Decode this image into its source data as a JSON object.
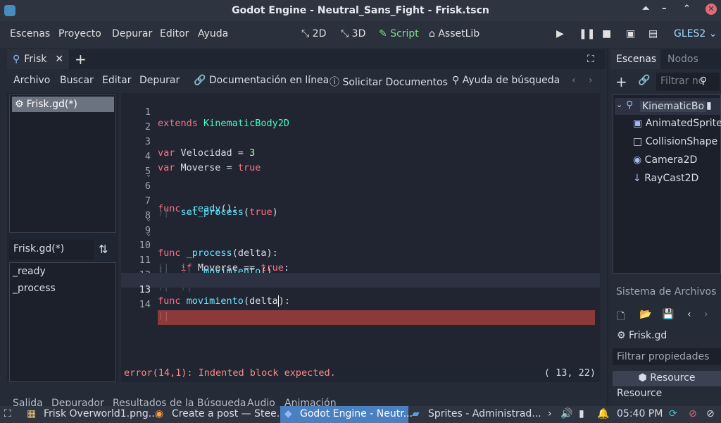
{
  "window": {
    "title": "Godot Engine - Neutral_Sans_Fight - Frisk.tscn"
  },
  "menu": {
    "items": [
      "Escenas",
      "Proyecto",
      "Depurar",
      "Editor",
      "Ayuda"
    ]
  },
  "modes": {
    "m2d": "2D",
    "m3d": "3D",
    "script": "Script",
    "assetlib": "AssetLib"
  },
  "renderer": "GLES2",
  "scene_tab": {
    "label": "Frisk"
  },
  "script_toolbar": {
    "archivo": "Archivo",
    "buscar": "Buscar",
    "editar": "Editar",
    "depurar": "Depurar",
    "docs_online": "Documentación en línea",
    "request_docs": "Solicitar Documentos",
    "search_help": "Ayuda de búsqueda"
  },
  "script_list": {
    "items": [
      "Frisk.gd(*)"
    ]
  },
  "filter": {
    "value": "Frisk.gd(*)"
  },
  "methods": [
    "_ready",
    "_process"
  ],
  "editor": {
    "lines": [
      {
        "n": "1"
      },
      {
        "n": "2"
      },
      {
        "n": "3"
      },
      {
        "n": "4"
      },
      {
        "n": "5"
      },
      {
        "n": "6"
      },
      {
        "n": "7"
      },
      {
        "n": "8"
      },
      {
        "n": "9"
      },
      {
        "n": "10"
      },
      {
        "n": "11"
      },
      {
        "n": "12"
      },
      {
        "n": "13"
      },
      {
        "n": "14"
      }
    ],
    "code": {
      "l1_kw": "extends",
      "l1_ty": "KinematicBody2D",
      "l3_kw": "var",
      "l3_rest": "Velocidad = ",
      "l3_num": "3",
      "l4_kw": "var",
      "l4_rest": "Moverse = ",
      "l4_val": "true",
      "l6_kw": "func",
      "l6_fn": "_ready",
      "l6_rest": "():",
      "l7_fn": "set_process",
      "l7_rest": "(",
      "l7_val": "true",
      "l7_end": ")",
      "l9_kw": "func",
      "l9_fn": "_process",
      "l9_rest": "(delta):",
      "l10_kw": "if",
      "l10_rest": "Moverse == ",
      "l10_val": "true",
      "l10_end": ":",
      "l11_fn": "movimiento",
      "l11_rest": "()",
      "l13_kw": "func",
      "l13_fn": "movimiento",
      "l13_rest": "(delta",
      "l13_end": "):"
    }
  },
  "status": {
    "error": "error(14,1): Indented block expected.",
    "position": "( 13, 22)"
  },
  "bottom_tabs": [
    "Salida",
    "Depurador",
    "Resultados de la Búsqueda",
    "Audio",
    "Animación"
  ],
  "right_dock": {
    "tabs": [
      "Escenas",
      "Nodos"
    ],
    "filter_placeholder": "Filtrar no",
    "nodes": [
      "KinematicBo",
      "AnimatedSprite",
      "CollisionShape",
      "Camera2D",
      "RayCast2D"
    ],
    "filesystem": "Sistema de Archivos",
    "inspected": "Frisk.gd",
    "filter_props": "Filtrar propiedades",
    "resource_header": "Resource",
    "resource_label": "Resource"
  },
  "taskbar": {
    "items": [
      "Frisk Overworld1.png...",
      "Create a post — Stee...",
      "Godot Engine - Neutr...",
      "Sprites - Administrad..."
    ],
    "clock": "05:40 PM"
  },
  "colors": {
    "accent": "#7fdc8a",
    "error_line": "#8a3a3a",
    "taskbar_active": "#4a7fc0"
  }
}
